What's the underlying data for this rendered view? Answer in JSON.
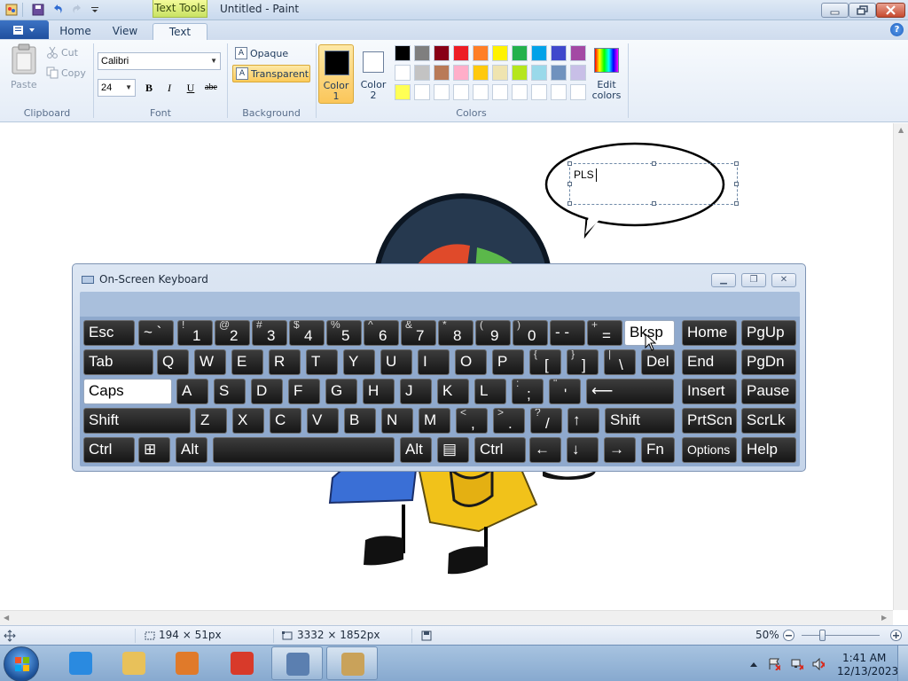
{
  "title_bar": {
    "contextual_tab": "Text Tools",
    "window_title": "Untitled - Paint",
    "minimize_icon": "minimize-icon",
    "maximize_icon": "restore-icon",
    "close_icon": "close-icon"
  },
  "ribbon_tabs": [
    {
      "label": "Home"
    },
    {
      "label": "View"
    },
    {
      "label": "Text"
    }
  ],
  "clipboard": {
    "paste_label": "Paste",
    "cut_label": "Cut",
    "copy_label": "Copy",
    "group_label": "Clipboard"
  },
  "font": {
    "family": "Calibri",
    "size": "24",
    "bold": "B",
    "italic": "I",
    "underline": "U",
    "strikethrough": "abe",
    "group_label": "Font"
  },
  "background": {
    "opaque_label": "Opaque",
    "transparent_label": "Transparent",
    "selected": "Transparent",
    "group_label": "Background"
  },
  "colors": {
    "color1_label": "Color\n1",
    "color1_value": "#000000",
    "color2_label": "Color\n2",
    "color2_value": "#ffffff",
    "group_label": "Colors",
    "edit_colors_label": "Edit\ncolors",
    "palette_row1": [
      "#000000",
      "#7f7f7f",
      "#880015",
      "#ed1c24",
      "#ff7f27",
      "#fff200",
      "#22b14c",
      "#00a2e8",
      "#3f48cc",
      "#a349a4"
    ],
    "palette_row2": [
      "#ffffff",
      "#c3c3c3",
      "#b97a57",
      "#ffaec9",
      "#ffc90e",
      "#efe4b0",
      "#b5e61d",
      "#99d9ea",
      "#7092be",
      "#c8bfe7"
    ],
    "palette_row3": [
      "#ffff55",
      "#ffffff",
      "#ffffff",
      "#ffffff",
      "#ffffff",
      "#ffffff",
      "#ffffff",
      "#ffffff",
      "#ffffff",
      "#ffffff"
    ]
  },
  "canvas": {
    "text_box_content": "PLS"
  },
  "osk": {
    "title": "On-Screen Keyboard",
    "rows": [
      [
        {
          "label": "Esc"
        },
        {
          "label": "~ `"
        },
        {
          "top": "!",
          "main": "1"
        },
        {
          "top": "@",
          "main": "2"
        },
        {
          "top": "#",
          "main": "3"
        },
        {
          "top": "$",
          "main": "4"
        },
        {
          "top": "%",
          "main": "5"
        },
        {
          "top": "^",
          "main": "6"
        },
        {
          "top": "&",
          "main": "7"
        },
        {
          "top": "*",
          "main": "8"
        },
        {
          "top": "(",
          "main": "9"
        },
        {
          "top": ")",
          "main": "0"
        },
        {
          "label": "- -"
        },
        {
          "top": "+",
          "main": "="
        },
        {
          "label": "Bksp"
        },
        {
          "label": "Home"
        },
        {
          "label": "PgUp"
        }
      ],
      [
        {
          "label": "Tab"
        },
        {
          "label": "Q"
        },
        {
          "label": "W"
        },
        {
          "label": "E"
        },
        {
          "label": "R"
        },
        {
          "label": "T"
        },
        {
          "label": "Y"
        },
        {
          "label": "U"
        },
        {
          "label": "I"
        },
        {
          "label": "O"
        },
        {
          "label": "P"
        },
        {
          "top": "{",
          "main": "["
        },
        {
          "top": "}",
          "main": "]"
        },
        {
          "top": "|",
          "main": "\\"
        },
        {
          "label": "Del"
        },
        {
          "label": "End"
        },
        {
          "label": "PgDn"
        }
      ],
      [
        {
          "label": "Caps"
        },
        {
          "label": "A"
        },
        {
          "label": "S"
        },
        {
          "label": "D"
        },
        {
          "label": "F"
        },
        {
          "label": "G"
        },
        {
          "label": "H"
        },
        {
          "label": "J"
        },
        {
          "label": "K"
        },
        {
          "label": "L"
        },
        {
          "top": ":",
          "main": ";"
        },
        {
          "top": "\"",
          "main": "'"
        },
        {
          "label": "⟵"
        },
        {
          "label": "Insert"
        },
        {
          "label": "Pause"
        }
      ],
      [
        {
          "label": "Shift"
        },
        {
          "label": "Z"
        },
        {
          "label": "X"
        },
        {
          "label": "C"
        },
        {
          "label": "V"
        },
        {
          "label": "B"
        },
        {
          "label": "N"
        },
        {
          "label": "M"
        },
        {
          "top": "<",
          "main": ","
        },
        {
          "top": ">",
          "main": "."
        },
        {
          "top": "?",
          "main": "/"
        },
        {
          "label": "↑"
        },
        {
          "label": "Shift"
        },
        {
          "label": "PrtScn"
        },
        {
          "label": "ScrLk"
        }
      ],
      [
        {
          "label": "Ctrl"
        },
        {
          "label": "⊞"
        },
        {
          "label": "Alt"
        },
        {
          "label": ""
        },
        {
          "label": "Alt"
        },
        {
          "label": "▤"
        },
        {
          "label": "Ctrl"
        },
        {
          "label": "←"
        },
        {
          "label": "↓"
        },
        {
          "label": "→"
        },
        {
          "label": "Fn"
        },
        {
          "label": "Options"
        },
        {
          "label": "Help"
        }
      ]
    ]
  },
  "status_bar": {
    "selection_size": "194 × 51px",
    "canvas_size": "3332 × 1852px",
    "zoom": "50%"
  },
  "taskbar": {
    "apps": [
      {
        "name": "internet-explorer-icon",
        "color": "#2a8ae0"
      },
      {
        "name": "file-explorer-icon",
        "color": "#e8c15a"
      },
      {
        "name": "media-player-icon",
        "color": "#e07a2a"
      },
      {
        "name": "chrome-icon",
        "color": "#d83a2a"
      },
      {
        "name": "on-screen-keyboard-icon",
        "color": "#5b7fb0"
      },
      {
        "name": "paint-icon",
        "color": "#c9a25a"
      }
    ],
    "time": "1:41 AM",
    "date": "12/13/2023"
  }
}
